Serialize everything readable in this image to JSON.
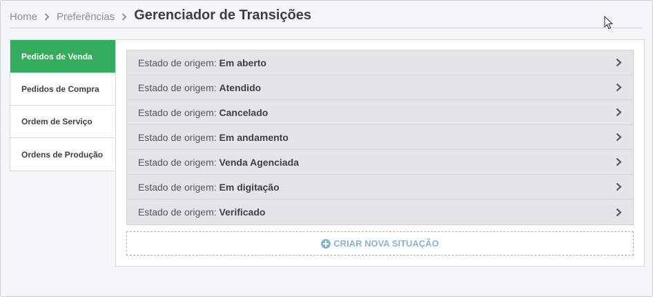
{
  "breadcrumb": {
    "home": "Home",
    "preferences": "Preferências",
    "current": "Gerenciador de Transições"
  },
  "sidebar": {
    "items": [
      {
        "label": "Pedidos de Venda",
        "active": true
      },
      {
        "label": "Pedidos de Compra",
        "active": false
      },
      {
        "label": "Ordem de Serviço",
        "active": false
      },
      {
        "label": "Ordens de Produção",
        "active": false
      }
    ]
  },
  "states": {
    "prefix": "Estado de origem:",
    "rows": [
      {
        "value": "Em aberto"
      },
      {
        "value": "Atendido"
      },
      {
        "value": "Cancelado"
      },
      {
        "value": "Em andamento"
      },
      {
        "value": "Venda Agenciada"
      },
      {
        "value": "Em digitação"
      },
      {
        "value": "Verificado"
      }
    ]
  },
  "create_button": {
    "label": "CRIAR NOVA SITUAÇÃO",
    "icon": "plus-circle-icon"
  },
  "colors": {
    "active_tab": "#33ad5d",
    "create_accent": "#8ab4cf",
    "row_bg": "#e4e5e6"
  }
}
